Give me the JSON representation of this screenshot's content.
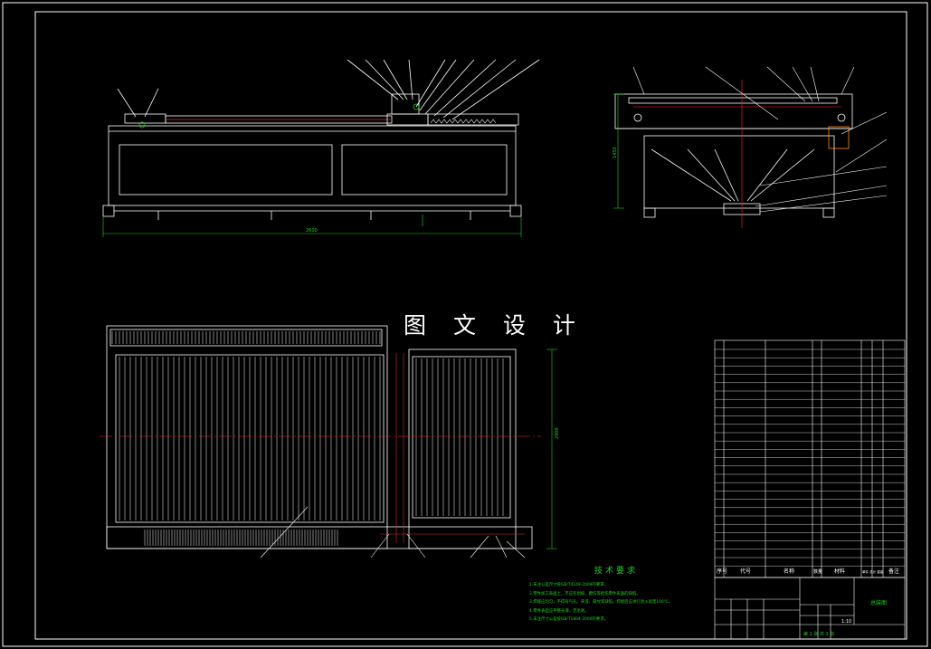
{
  "watermark": "图 文 设 计",
  "technical_requirements": {
    "title": "技术要求",
    "notes": [
      "1.未注公差尺寸按GB/T4249-2009的要求。",
      "2.零件加工表面上，不应有划痕、擦伤等损伤零件表面的缺陷。",
      "3.焊缝应均匀，不得有气孔、夹渣、裂纹等缺陷。焊接后应进行退火处理100℃。",
      "4.零件表面应平整光滑，无毛刺。",
      "5.未注尺寸公差按GB/T1804-2000的要求。"
    ]
  },
  "dimensions": {
    "overall_length": "2600",
    "side_height": "1450",
    "plan_width": "2900"
  },
  "bom_header": {
    "no": "序号",
    "code": "代号",
    "name": "名称",
    "qty": "数量",
    "material": "材料",
    "weight": "单件 总计 重量",
    "remark": "备注"
  },
  "title_block": {
    "drawing_name": "总装图",
    "scale": "1:10",
    "sheet": "第 1 张  共 1 张"
  },
  "colors": {
    "background": "#000000",
    "outline": "#ffffff",
    "dimension": "#1fd11f",
    "centerline": "#ff2020",
    "hidden": "#d03030"
  }
}
